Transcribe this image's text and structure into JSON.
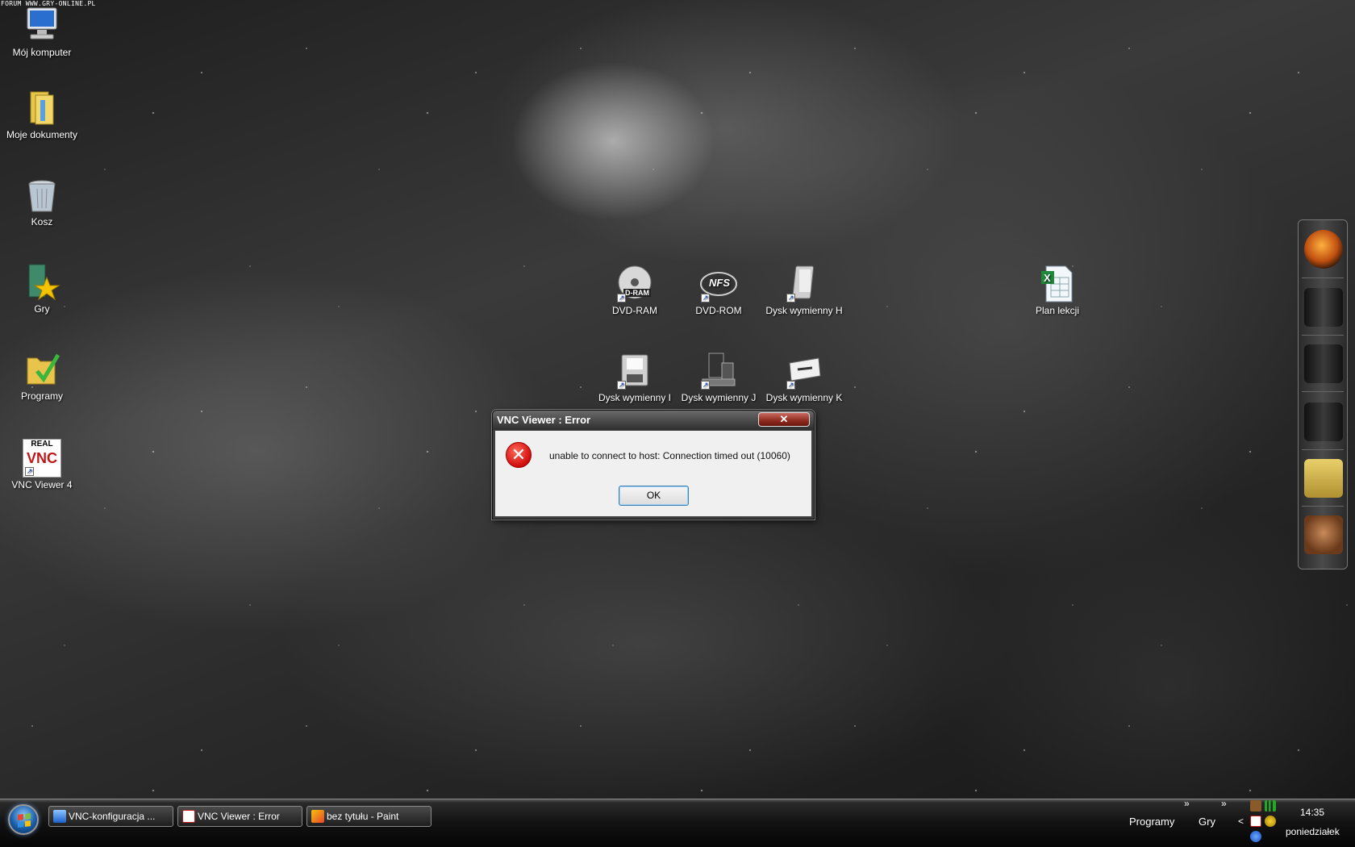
{
  "watermark": "FORUM WWW.GRY-ONLINE.PL",
  "desktop_icons": [
    {
      "label": "Mój komputer"
    },
    {
      "label": "Moje dokumenty"
    },
    {
      "label": "Kosz"
    },
    {
      "label": "Gry"
    },
    {
      "label": "Programy"
    },
    {
      "label": "VNC Viewer 4"
    },
    {
      "label": "DVD-RAM"
    },
    {
      "label": "DVD-ROM"
    },
    {
      "label": "Dysk wymienny H"
    },
    {
      "label": "Plan lekcji"
    },
    {
      "label": "Dysk wymienny I"
    },
    {
      "label": "Dysk wymienny J"
    },
    {
      "label": "Dysk wymienny K"
    }
  ],
  "dvd_ram_badge": "D-RAM",
  "nfs_badge": "NFS",
  "vnc_logo_top": "REAL",
  "vnc_logo_bottom": "VNC",
  "dialog": {
    "title": "VNC Viewer : Error",
    "close_glyph": "✕",
    "error_glyph": "✕",
    "message": "unable to connect to host: Connection timed out (10060)",
    "ok_label": "OK"
  },
  "taskbar": {
    "buttons": [
      {
        "label": "VNC-konfiguracja ..."
      },
      {
        "label": "VNC Viewer : Error"
      },
      {
        "label": "bez tytułu - Paint"
      }
    ],
    "toolbar_programy": "Programy",
    "toolbar_gry": "Gry",
    "chevron": "»",
    "tray_arrow": "<",
    "clock_time": "14:35",
    "clock_day": "poniedziałek"
  },
  "icons": {
    "start": "windows-orb",
    "error": "error-x",
    "accent_red": "#d10c0c",
    "accent_blue": "#3c7fb1"
  }
}
